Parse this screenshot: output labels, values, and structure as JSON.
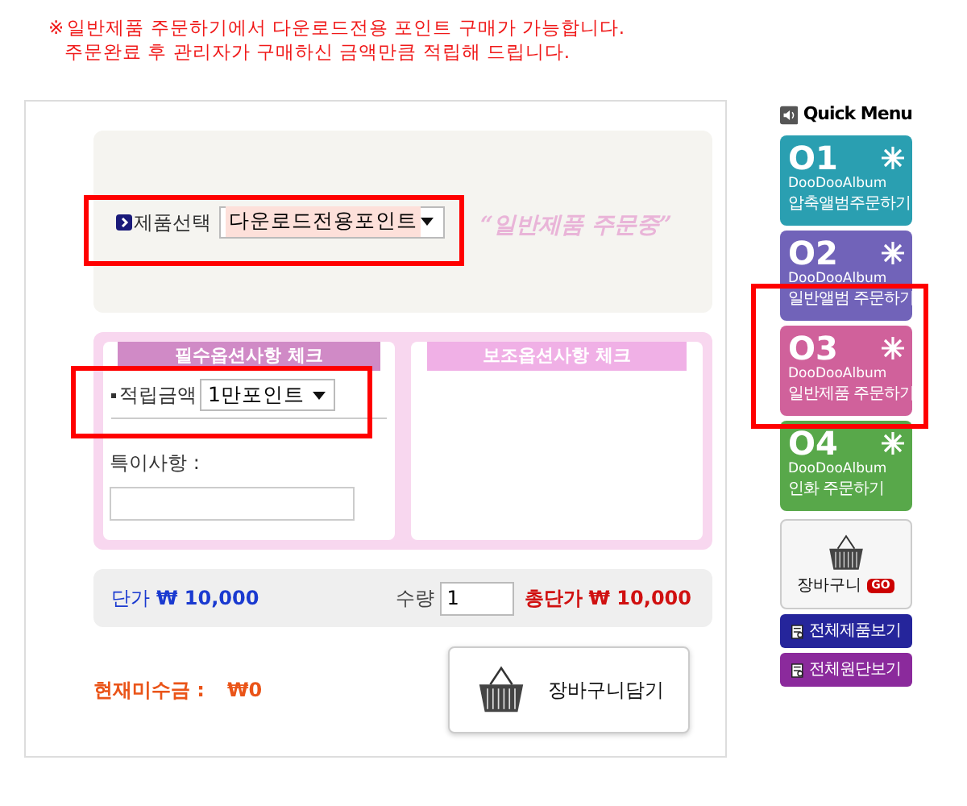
{
  "notice": {
    "mark": "※",
    "lines": [
      "일반제품 주문하기에서 다운로드전용 포인트 구매가 가능합니다.",
      "주문완료 후 관리자가 구매하신 금액만큼 적립해 드립니다."
    ]
  },
  "product": {
    "label": "제품선택",
    "value": "다운로드전용포인트",
    "highlighted": true,
    "status_text": "“일반제품 주문중”"
  },
  "required_options": {
    "title": "필수옵션사항 체크",
    "amount_label": "적립금액",
    "amount_value": "1만포인트",
    "highlighted": true,
    "note_label": "특이사항 :"
  },
  "optional_options": {
    "title": "보조옵션사항 체크"
  },
  "price": {
    "unit_label": "단가",
    "unit_value": "₩ 10,000",
    "qty_label": "수량",
    "qty_value": "1",
    "total_label": "총단가",
    "total_value": "₩ 10,000"
  },
  "unpaid": {
    "label": "현재미수금 :",
    "value": "₩0"
  },
  "cart_button": {
    "label": "장바구니담기"
  },
  "quick_menu": {
    "title": "Quick Menu",
    "items": [
      {
        "number": "O1",
        "brand": "DooDooAlbum",
        "label": "압축앨범주문하기",
        "color": "#2a9fb1",
        "highlighted": false
      },
      {
        "number": "O2",
        "brand": "DooDooAlbum",
        "label": "일반앨범 주문하기",
        "color": "#7163b9",
        "highlighted": false
      },
      {
        "number": "O3",
        "brand": "DooDooAlbum",
        "label": "일반제품 주문하기",
        "color": "#d0619b",
        "highlighted": true
      },
      {
        "number": "O4",
        "brand": "DooDooAlbum",
        "label": "인화 주문하기",
        "color": "#58a84a",
        "highlighted": false
      }
    ],
    "cart": {
      "label": "장바구니",
      "badge": "GO"
    },
    "links": [
      {
        "label": "전체제품보기",
        "color": "#25259b"
      },
      {
        "label": "전체원단보기",
        "color": "#8b2a9c"
      }
    ]
  }
}
